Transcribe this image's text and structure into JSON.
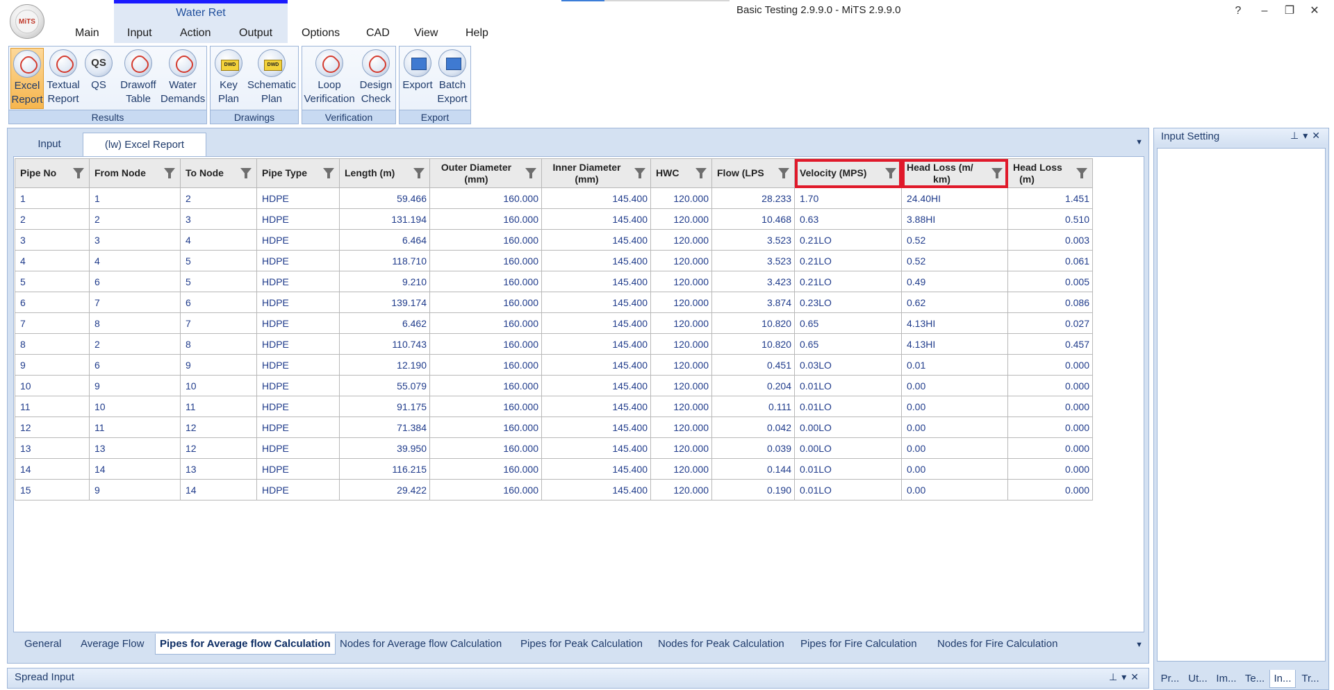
{
  "window": {
    "title": "Basic Testing 2.9.9.0 - MiTS 2.9.9.0",
    "logo_text": "MiTS",
    "context_title": "Water Ret",
    "controls": {
      "help": "?",
      "minimize": "–",
      "restore": "❐",
      "close": "✕"
    }
  },
  "ribbon_tabs": [
    "Main",
    "Input",
    "Action",
    "Output",
    "Options",
    "CAD",
    "View",
    "Help"
  ],
  "ribbon_groups": {
    "results": {
      "name": "Results",
      "buttons": [
        {
          "line1": "Excel",
          "line2": "Report",
          "icon": "pdf-report-icon",
          "active": true
        },
        {
          "line1": "Textual",
          "line2": "Report",
          "icon": "pdf-report-icon"
        },
        {
          "line1": "QS",
          "line2": "",
          "icon": "qs-icon"
        },
        {
          "line1": "Drawoff",
          "line2": "Table",
          "icon": "pdf-report-icon"
        },
        {
          "line1": "Water",
          "line2": "Demands",
          "icon": "pdf-report-icon"
        }
      ]
    },
    "drawings": {
      "name": "Drawings",
      "buttons": [
        {
          "line1": "Key",
          "line2": "Plan",
          "icon": "dwd-icon"
        },
        {
          "line1": "Schematic",
          "line2": "Plan",
          "icon": "dwd-icon"
        }
      ]
    },
    "verification": {
      "name": "Verification",
      "buttons": [
        {
          "line1": "Loop",
          "line2": "Verification",
          "icon": "pdf-report-icon"
        },
        {
          "line1": "Design",
          "line2": "Check",
          "icon": "pdf-report-icon"
        }
      ]
    },
    "export": {
      "name": "Export",
      "buttons": [
        {
          "line1": "Export",
          "line2": "",
          "icon": "export-icon"
        },
        {
          "line1": "Batch",
          "line2": "Export",
          "icon": "export-icon"
        }
      ]
    }
  },
  "doc_tabs": [
    {
      "label": "Input",
      "selected": false
    },
    {
      "label": "(lw) Excel Report",
      "selected": true
    }
  ],
  "grid": {
    "columns": [
      {
        "label1": "Pipe No",
        "label2": ""
      },
      {
        "label1": "From Node",
        "label2": ""
      },
      {
        "label1": "To Node",
        "label2": ""
      },
      {
        "label1": "Pipe Type",
        "label2": ""
      },
      {
        "label1": "Length (m)",
        "label2": ""
      },
      {
        "label1": "Outer Diameter",
        "label2": "(mm)"
      },
      {
        "label1": "Inner Diameter",
        "label2": "(mm)"
      },
      {
        "label1": "HWC",
        "label2": ""
      },
      {
        "label1": "Flow (LPS",
        "label2": ""
      },
      {
        "label1": "Velocity (MPS)",
        "label2": ""
      },
      {
        "label1": "Head Loss (m/",
        "label2": "km)"
      },
      {
        "label1": "Head Loss",
        "label2": "(m)"
      }
    ],
    "rows": [
      [
        "1",
        "1",
        "2",
        "HDPE",
        "59.466",
        "160.000",
        "145.400",
        "120.000",
        "28.233",
        "1.70",
        "24.40HI",
        "1.451"
      ],
      [
        "2",
        "2",
        "3",
        "HDPE",
        "131.194",
        "160.000",
        "145.400",
        "120.000",
        "10.468",
        "0.63",
        "3.88HI",
        "0.510"
      ],
      [
        "3",
        "3",
        "4",
        "HDPE",
        "6.464",
        "160.000",
        "145.400",
        "120.000",
        "3.523",
        "0.21LO",
        "0.52",
        "0.003"
      ],
      [
        "4",
        "4",
        "5",
        "HDPE",
        "118.710",
        "160.000",
        "145.400",
        "120.000",
        "3.523",
        "0.21LO",
        "0.52",
        "0.061"
      ],
      [
        "5",
        "6",
        "5",
        "HDPE",
        "9.210",
        "160.000",
        "145.400",
        "120.000",
        "3.423",
        "0.21LO",
        "0.49",
        "0.005"
      ],
      [
        "6",
        "7",
        "6",
        "HDPE",
        "139.174",
        "160.000",
        "145.400",
        "120.000",
        "3.874",
        "0.23LO",
        "0.62",
        "0.086"
      ],
      [
        "7",
        "8",
        "7",
        "HDPE",
        "6.462",
        "160.000",
        "145.400",
        "120.000",
        "10.820",
        "0.65",
        "4.13HI",
        "0.027"
      ],
      [
        "8",
        "2",
        "8",
        "HDPE",
        "110.743",
        "160.000",
        "145.400",
        "120.000",
        "10.820",
        "0.65",
        "4.13HI",
        "0.457"
      ],
      [
        "9",
        "6",
        "9",
        "HDPE",
        "12.190",
        "160.000",
        "145.400",
        "120.000",
        "0.451",
        "0.03LO",
        "0.01",
        "0.000"
      ],
      [
        "10",
        "9",
        "10",
        "HDPE",
        "55.079",
        "160.000",
        "145.400",
        "120.000",
        "0.204",
        "0.01LO",
        "0.00",
        "0.000"
      ],
      [
        "11",
        "10",
        "11",
        "HDPE",
        "91.175",
        "160.000",
        "145.400",
        "120.000",
        "0.111",
        "0.01LO",
        "0.00",
        "0.000"
      ],
      [
        "12",
        "11",
        "12",
        "HDPE",
        "71.384",
        "160.000",
        "145.400",
        "120.000",
        "0.042",
        "0.00LO",
        "0.00",
        "0.000"
      ],
      [
        "13",
        "13",
        "12",
        "HDPE",
        "39.950",
        "160.000",
        "145.400",
        "120.000",
        "0.039",
        "0.00LO",
        "0.00",
        "0.000"
      ],
      [
        "14",
        "14",
        "13",
        "HDPE",
        "116.215",
        "160.000",
        "145.400",
        "120.000",
        "0.144",
        "0.01LO",
        "0.00",
        "0.000"
      ],
      [
        "15",
        "9",
        "14",
        "HDPE",
        "29.422",
        "160.000",
        "145.400",
        "120.000",
        "0.190",
        "0.01LO",
        "0.00",
        "0.000"
      ]
    ]
  },
  "sheet_tabs": [
    {
      "label": "General",
      "selected": false
    },
    {
      "label": "Average Flow",
      "selected": false
    },
    {
      "label": "Pipes for Average flow Calculation",
      "selected": true
    },
    {
      "label": "Nodes for Average flow Calculation",
      "selected": false
    },
    {
      "label": "Pipes for Peak Calculation",
      "selected": false
    },
    {
      "label": "Nodes for Peak Calculation",
      "selected": false
    },
    {
      "label": "Pipes for Fire Calculation",
      "selected": false
    },
    {
      "label": "Nodes for Fire Calculation",
      "selected": false
    }
  ],
  "right_panel": {
    "title": "Input Setting",
    "tabs": [
      "Pr...",
      "Ut...",
      "Im...",
      "Te...",
      "In...",
      "Tr..."
    ],
    "selected_tab": "In..."
  },
  "bottom_panel": {
    "title": "Spread Input"
  },
  "highlight_color": "#e0192a"
}
